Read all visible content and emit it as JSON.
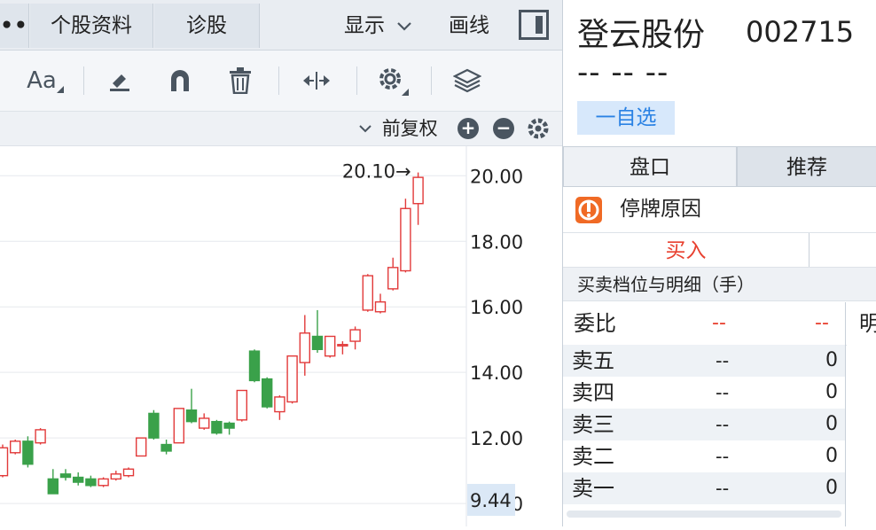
{
  "topbar": {
    "more_label": "••",
    "tab_profile": "个股资料",
    "tab_diagnose": "诊股",
    "show_label": "显示",
    "draw_label": "画线"
  },
  "toolbar": {
    "text_icon_label": "Aa"
  },
  "subbar": {
    "adjust_label": "前复权",
    "zoom_in": "+",
    "zoom_out": "−"
  },
  "chart_data": {
    "type": "candlestick",
    "y_ticks": [
      "20.00",
      "18.00",
      "16.00",
      "14.00",
      "12.00",
      "10.00"
    ],
    "ylim": [
      9.3,
      20.9
    ],
    "current_price_label": "9.44",
    "max_marker_label": "20.10→",
    "up_color": "#e23a3a",
    "down_color": "#3aa14a",
    "candles": [
      {
        "o": 10.85,
        "c": 11.7,
        "h": 11.8,
        "l": 10.8
      },
      {
        "o": 11.55,
        "c": 11.9,
        "h": 11.95,
        "l": 11.5
      },
      {
        "o": 11.9,
        "c": 11.2,
        "h": 12.05,
        "l": 11.1
      },
      {
        "o": 11.85,
        "c": 12.25,
        "h": 12.3,
        "l": 11.8
      },
      {
        "o": 10.75,
        "c": 10.3,
        "h": 11.05,
        "l": 10.5
      },
      {
        "o": 10.9,
        "c": 10.8,
        "h": 11.05,
        "l": 10.7
      },
      {
        "o": 10.8,
        "c": 10.65,
        "h": 10.95,
        "l": 10.55
      },
      {
        "o": 10.75,
        "c": 10.55,
        "h": 10.85,
        "l": 10.5
      },
      {
        "o": 10.55,
        "c": 10.75,
        "h": 10.8,
        "l": 10.5
      },
      {
        "o": 10.75,
        "c": 10.9,
        "h": 11.0,
        "l": 10.7
      },
      {
        "o": 10.85,
        "c": 11.05,
        "h": 11.1,
        "l": 10.8
      },
      {
        "o": 11.45,
        "c": 12.0,
        "h": 12.0,
        "l": 11.45
      },
      {
        "o": 12.75,
        "c": 12.0,
        "h": 12.85,
        "l": 11.95
      },
      {
        "o": 11.8,
        "c": 11.6,
        "h": 11.95,
        "l": 11.5
      },
      {
        "o": 11.85,
        "c": 12.9,
        "h": 12.9,
        "l": 11.85
      },
      {
        "o": 12.85,
        "c": 12.5,
        "h": 13.5,
        "l": 12.45
      },
      {
        "o": 12.3,
        "c": 12.6,
        "h": 12.75,
        "l": 12.25
      },
      {
        "o": 12.5,
        "c": 12.15,
        "h": 12.55,
        "l": 12.1
      },
      {
        "o": 12.45,
        "c": 12.3,
        "h": 12.5,
        "l": 12.1
      },
      {
        "o": 12.55,
        "c": 13.45,
        "h": 13.45,
        "l": 12.5
      },
      {
        "o": 14.65,
        "c": 13.75,
        "h": 14.7,
        "l": 13.7
      },
      {
        "o": 13.8,
        "c": 12.95,
        "h": 13.85,
        "l": 12.9
      },
      {
        "o": 12.8,
        "c": 13.25,
        "h": 13.3,
        "l": 12.55
      },
      {
        "o": 13.1,
        "c": 14.5,
        "h": 14.5,
        "l": 13.05
      },
      {
        "o": 14.3,
        "c": 15.2,
        "h": 15.75,
        "l": 13.9
      },
      {
        "o": 15.1,
        "c": 14.7,
        "h": 15.9,
        "l": 14.6
      },
      {
        "o": 14.5,
        "c": 15.1,
        "h": 15.1,
        "l": 14.45
      },
      {
        "o": 14.85,
        "c": 14.85,
        "h": 14.95,
        "l": 14.55
      },
      {
        "o": 14.95,
        "c": 15.3,
        "h": 15.4,
        "l": 14.7
      },
      {
        "o": 15.9,
        "c": 16.95,
        "h": 17.0,
        "l": 15.85
      },
      {
        "o": 15.85,
        "c": 16.15,
        "h": 16.4,
        "l": 15.8
      },
      {
        "o": 16.55,
        "c": 17.2,
        "h": 17.5,
        "l": 16.5
      },
      {
        "o": 17.1,
        "c": 19.0,
        "h": 19.3,
        "l": 17.05
      },
      {
        "o": 19.15,
        "c": 19.95,
        "h": 20.1,
        "l": 18.5
      }
    ]
  },
  "stock": {
    "name": "登云股份",
    "code": "002715",
    "price": "-- -- --",
    "watch_label": "一自选"
  },
  "right_tabs": {
    "quote": "盘口",
    "recommend": "推荐"
  },
  "halt": {
    "label": "停牌原因"
  },
  "trade": {
    "buy_label": "买入"
  },
  "depth": {
    "title": "买卖档位与明细（手）",
    "ratio_label": "委比",
    "ratio_v1": "--",
    "ratio_v2": "--",
    "detail_header": "明",
    "asks": [
      {
        "name": "卖五",
        "price": "--",
        "vol": "0"
      },
      {
        "name": "卖四",
        "price": "--",
        "vol": "0"
      },
      {
        "name": "卖三",
        "price": "--",
        "vol": "0"
      },
      {
        "name": "卖二",
        "price": "--",
        "vol": "0"
      },
      {
        "name": "卖一",
        "price": "--",
        "vol": "0"
      }
    ]
  }
}
